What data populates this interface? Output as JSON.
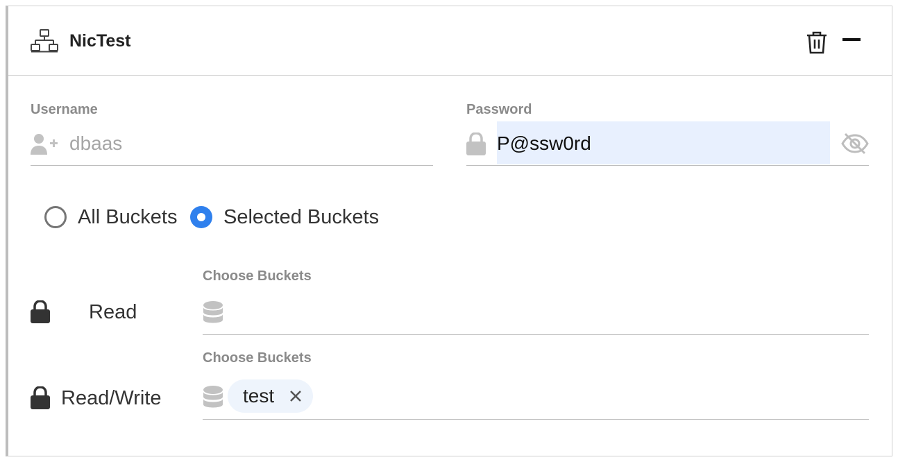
{
  "header": {
    "title": "NicTest",
    "icon": "network-icon",
    "actions": [
      "delete-icon",
      "minimize-icon"
    ]
  },
  "username": {
    "label": "Username",
    "value": "dbaas",
    "icon": "user-add-icon"
  },
  "password": {
    "label": "Password",
    "value": "P@ssw0rd",
    "icon": "lock-icon",
    "toggle_icon": "eye-slash-icon"
  },
  "scope": {
    "options": [
      {
        "label": "All Buckets",
        "selected": false
      },
      {
        "label": "Selected Buckets",
        "selected": true
      }
    ]
  },
  "permissions": [
    {
      "label": "Read",
      "bucket_label": "Choose Buckets",
      "buckets": []
    },
    {
      "label": "Read/Write",
      "bucket_label": "Choose Buckets",
      "buckets": [
        "test"
      ]
    }
  ],
  "colors": {
    "accent": "#2f80ed",
    "label_gray": "#8a8a8a",
    "autofill_bg": "#e8f0fe",
    "chip_bg": "#eef4fc"
  }
}
